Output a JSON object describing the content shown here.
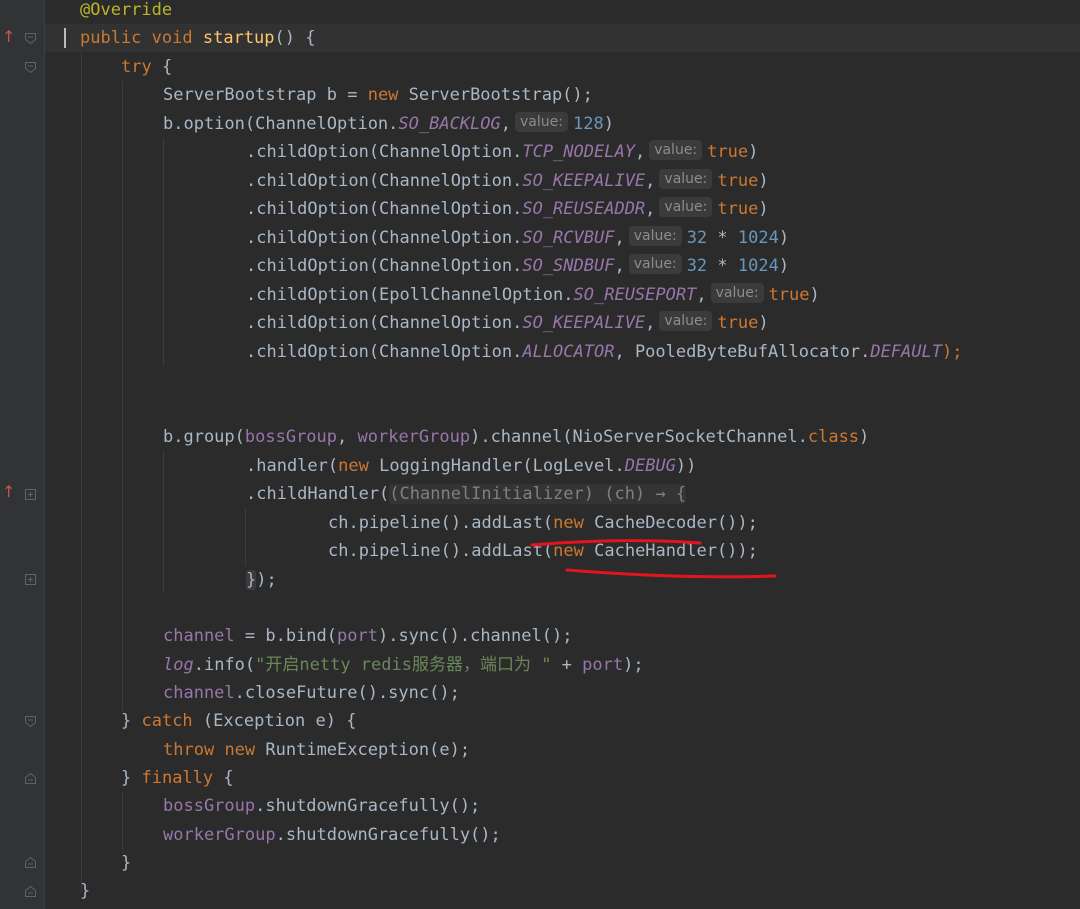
{
  "editor": {
    "lines": [
      "@Override",
      "public void startup() {",
      "try {",
      "ServerBootstrap b = new ServerBootstrap();",
      "b.option(ChannelOption.SO_BACKLOG, value: 128)",
      ".childOption(ChannelOption.TCP_NODELAY, value: true)",
      ".childOption(ChannelOption.SO_KEEPALIVE, value: true)",
      ".childOption(ChannelOption.SO_REUSEADDR, value: true)",
      ".childOption(ChannelOption.SO_RCVBUF, value: 32 * 1024)",
      ".childOption(ChannelOption.SO_SNDBUF, value: 32 * 1024)",
      ".childOption(EpollChannelOption.SO_REUSEPORT, value: true)",
      ".childOption(ChannelOption.SO_KEEPALIVE, value: true)",
      ".childOption(ChannelOption.ALLOCATOR, PooledByteBufAllocator.DEFAULT);",
      "",
      "",
      "b.group(bossGroup, workerGroup).channel(NioServerSocketChannel.class)",
      ".handler(new LoggingHandler(LogLevel.DEBUG))",
      ".childHandler((ChannelInitializer) (ch) → {",
      "ch.pipeline().addLast(new CacheDecoder());",
      "ch.pipeline().addLast(new CacheHandler());",
      "});",
      "",
      "channel = b.bind(port).sync().channel();",
      "log.info(\"开启netty redis服务器，端口为 \" + port);",
      "channel.closeFuture().sync();",
      "} catch (Exception e) {",
      "throw new RuntimeException(e);",
      "} finally {",
      "bossGroup.shutdownGracefully();",
      "workerGroup.shutdownGracefully();",
      "}",
      "}"
    ],
    "tokens": {
      "override": "@Override",
      "public": "public",
      "void": "void",
      "startup": "startup",
      "startup_rest": "() {",
      "try": "try",
      "brace_open": " {",
      "sb_type": "ServerBootstrap b = ",
      "new": "new",
      "sb_ctor": " ServerBootstrap();",
      "b_option": "b.option(ChannelOption.",
      "child_option": ".childOption(ChannelOption.",
      "child_option_epoll": ".childOption(EpollChannelOption.",
      "so_backlog": "SO_BACKLOG",
      "tcp_nodelay": "TCP_NODELAY",
      "so_keepalive": "SO_KEEPALIVE",
      "so_reuseaddr": "SO_REUSEADDR",
      "so_rcvbuf": "SO_RCVBUF",
      "so_sndbuf": "SO_SNDBUF",
      "so_reuseport": "SO_REUSEPORT",
      "allocator": "ALLOCATOR",
      "allocator_mid": ", PooledByteBufAllocator.",
      "default": "DEFAULT",
      "stmt_end": ");",
      "comma": ",",
      "hint": "value:",
      "n128": "128",
      "n32": "32",
      "times": " * ",
      "n1024": "1024",
      "true": "true",
      "close_paren": ")",
      "b_group": "b.group(",
      "boss_group": "bossGroup",
      "comma_sp": ", ",
      "worker_group": "workerGroup",
      "channel_call": ").channel(NioServerSocketChannel.",
      "class": "class",
      "handler_start": ".handler(",
      "logging_handler": " LoggingHandler(LogLevel.",
      "debug": "DEBUG",
      "double_close": "))",
      "child_handler": ".childHandler(",
      "lambda": "(ChannelInitializer) (ch) → {",
      "pipeline": "ch.pipeline().addLast(",
      "cache_decoder": " CacheDecoder());",
      "cache_handler": " CacheHandler());",
      "lambda_close": "}",
      "lambda_end": ");",
      "channel": "channel",
      "bind": " = b.bind(",
      "port": "port",
      "sync_channel": ").sync().channel();",
      "log": "log",
      "info": ".info(",
      "log_str": "\"开启netty redis服务器，端口为 \"",
      "plus": " + ",
      "close_future": ".closeFuture().sync();",
      "catch_open": "} ",
      "catch": "catch",
      "catch_rest": " (Exception e) {",
      "throw": "throw",
      "runtime": " RuntimeException(e);",
      "finally": "finally",
      "shutdown": ".shutdownGracefully();",
      "close_brace": "}"
    }
  },
  "gutter": {
    "override_marker_icon": "override-arrow-icon",
    "fold_icon": "fold-icon",
    "arrow_glyph": "↑"
  },
  "colors": {
    "background": "#2b2b2b",
    "keyword": "#cc7832",
    "annotation": "#bbb529",
    "method": "#ffc66d",
    "field": "#9876aa",
    "number": "#6897bb",
    "string": "#6a8759",
    "plain": "#a9b7c6",
    "underline": "#e3141e"
  }
}
